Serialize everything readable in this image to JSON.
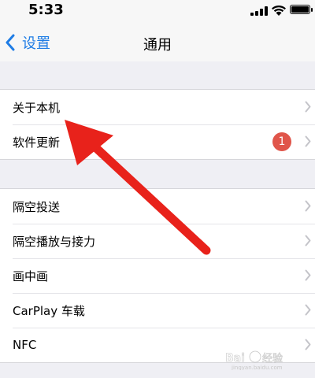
{
  "status_bar": {
    "time": "5:33"
  },
  "nav": {
    "back_label": "设置",
    "title": "通用"
  },
  "groups": [
    {
      "items": [
        {
          "label": "关于本机"
        },
        {
          "label": "软件更新",
          "badge": "1"
        }
      ]
    },
    {
      "items": [
        {
          "label": "隔空投送"
        },
        {
          "label": "隔空播放与接力"
        },
        {
          "label": "画中画"
        },
        {
          "label": "CarPlay 车载"
        },
        {
          "label": "NFC"
        }
      ]
    }
  ],
  "colors": {
    "accent": "#1e7ce5",
    "badge": "#e0554a",
    "annotation_arrow": "#e8221b"
  },
  "watermark": {
    "text": "Baidu经验",
    "sub": "jingyan.baidu.com"
  }
}
